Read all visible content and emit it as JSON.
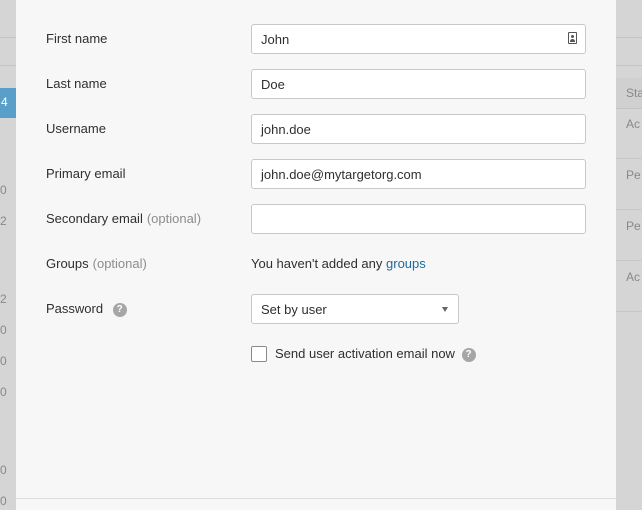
{
  "background": {
    "row_numbers": [
      "4",
      "0",
      "2",
      "2",
      "0",
      "0",
      "0",
      "0",
      "0"
    ],
    "column_header": "Sta",
    "cells": [
      "Ac",
      "Pe",
      "Pe",
      "Ac"
    ]
  },
  "form": {
    "first_name": {
      "label": "First name",
      "value": "John"
    },
    "last_name": {
      "label": "Last name",
      "value": "Doe"
    },
    "username": {
      "label": "Username",
      "value": "john.doe"
    },
    "primary_email": {
      "label": "Primary email",
      "value": "john.doe@mytargetorg.com"
    },
    "secondary_email": {
      "label": "Secondary email",
      "optional": "(optional)",
      "value": ""
    },
    "groups": {
      "label": "Groups",
      "optional": "(optional)",
      "empty_text": "You haven't added any ",
      "link_text": "groups"
    },
    "password": {
      "label": "Password",
      "help": "?",
      "selected": "Set by user"
    },
    "activation": {
      "label": "Send user activation email now",
      "help": "?",
      "checked": false
    }
  }
}
